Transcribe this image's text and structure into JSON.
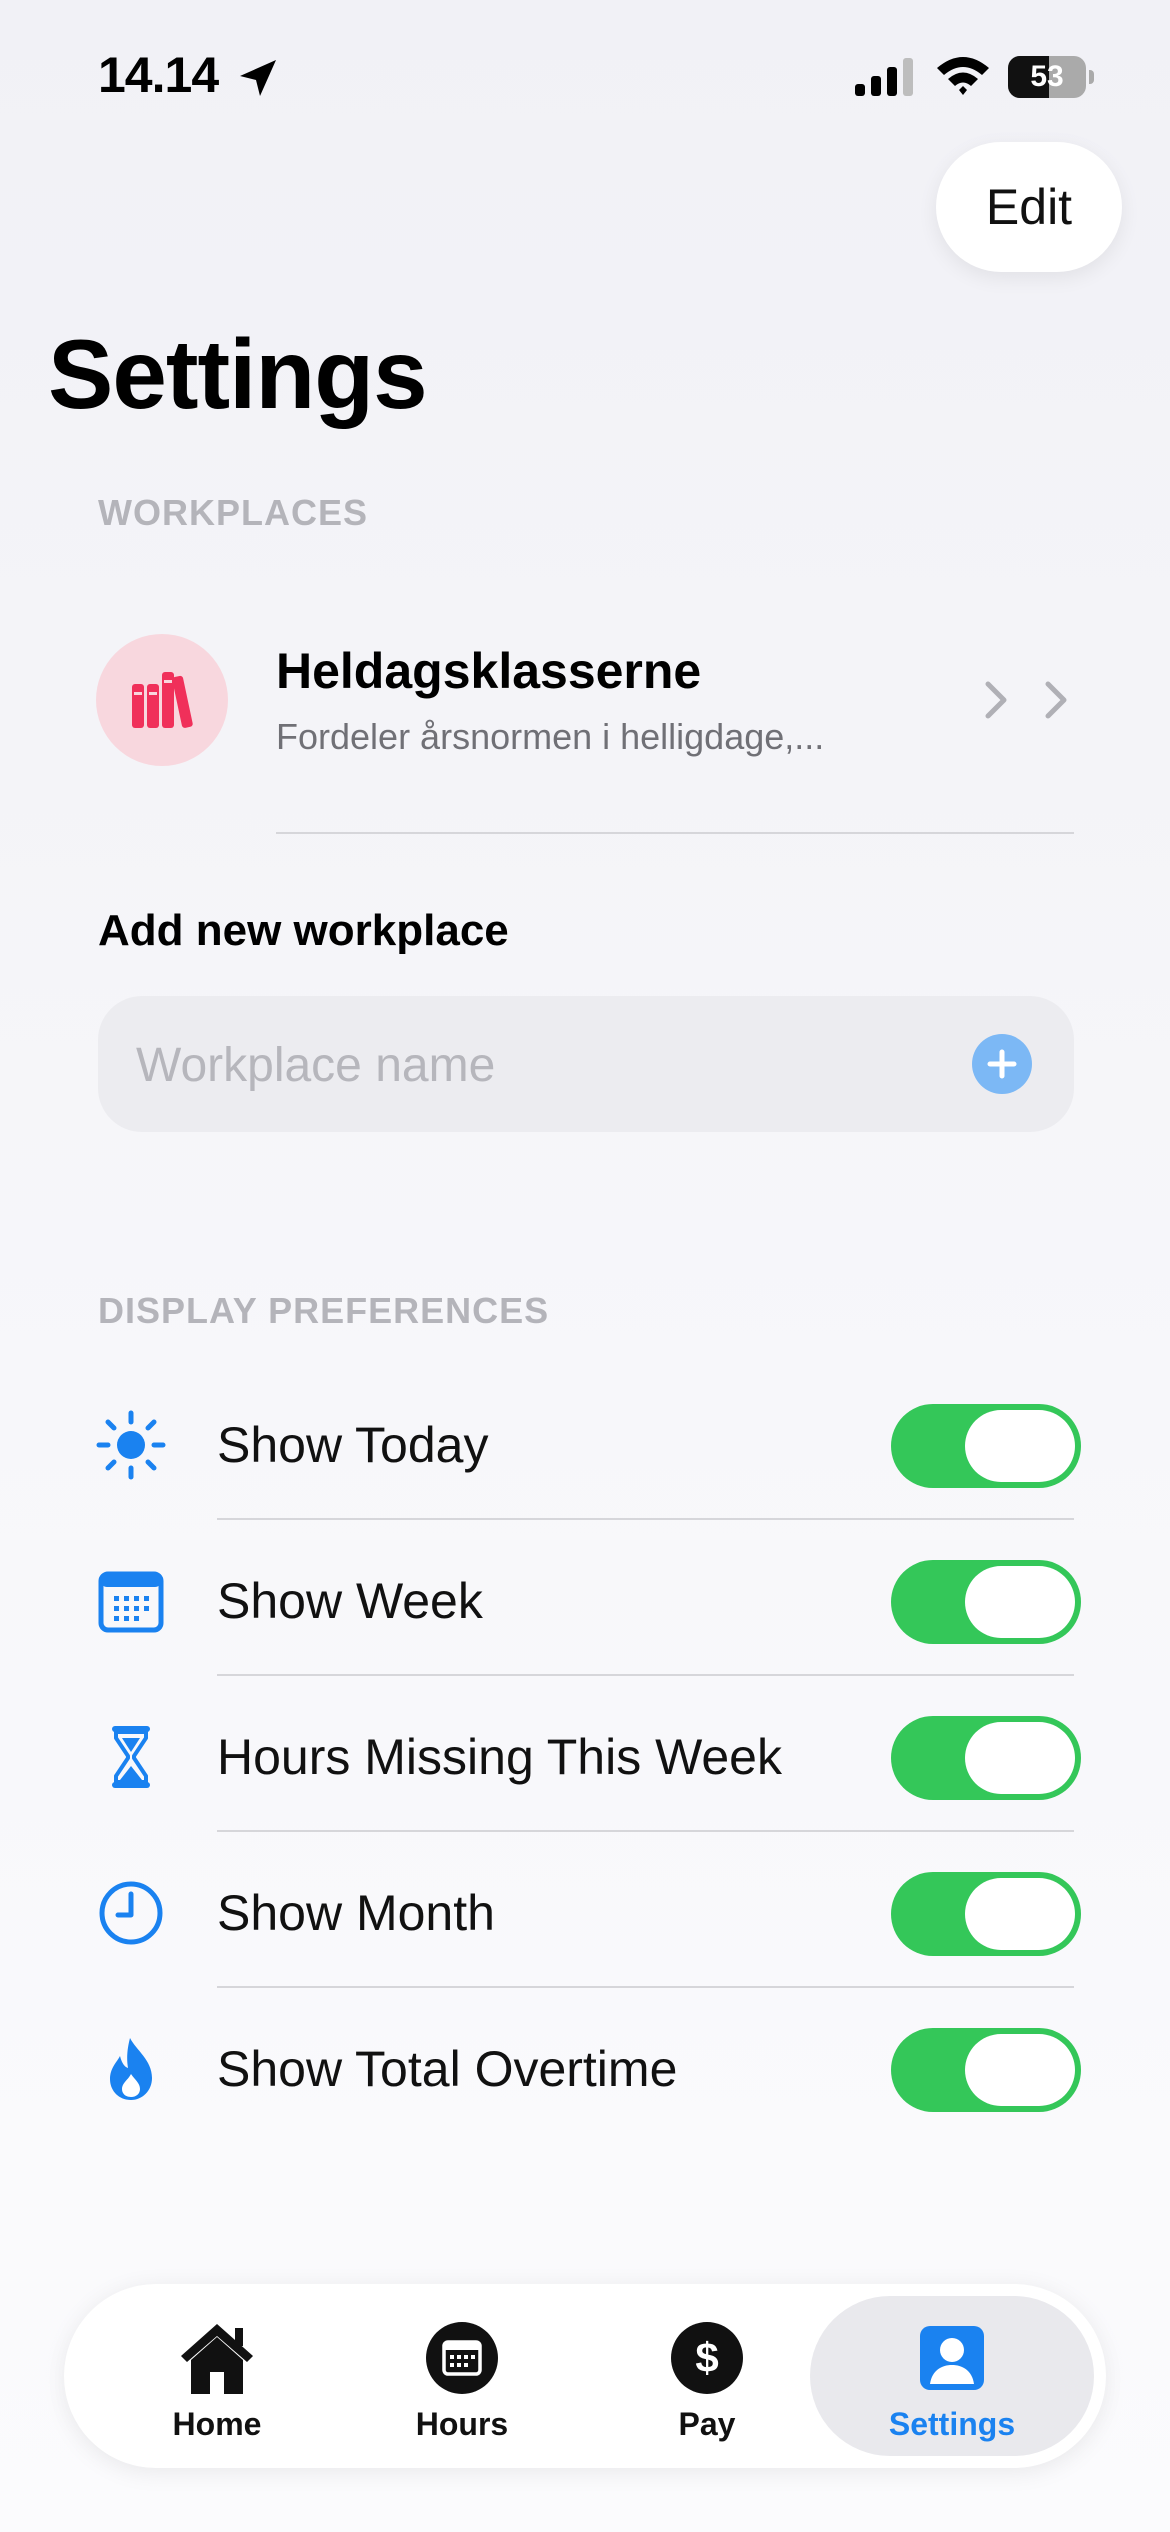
{
  "status_bar": {
    "time": "14.14",
    "battery": "53"
  },
  "header": {
    "edit_label": "Edit",
    "title": "Settings"
  },
  "workplaces": {
    "section_title": "WORKPLACES",
    "items": [
      {
        "name": "Heldagsklasserne",
        "subtitle": "Fordeler årsnormen i helligdage,..."
      }
    ],
    "add_label": "Add new workplace",
    "input_placeholder": "Workplace name",
    "input_value": ""
  },
  "display_preferences": {
    "section_title": "DISPLAY PREFERENCES",
    "items": [
      {
        "label": "Show Today",
        "icon": "sun-icon",
        "enabled": true
      },
      {
        "label": "Show Week",
        "icon": "calendar-icon",
        "enabled": true
      },
      {
        "label": "Hours Missing This Week",
        "icon": "hourglass-icon",
        "enabled": true
      },
      {
        "label": "Show Month",
        "icon": "clock-icon",
        "enabled": true
      },
      {
        "label": "Show Total Overtime",
        "icon": "flame-icon",
        "enabled": true
      }
    ]
  },
  "tab_bar": {
    "tabs": [
      {
        "label": "Home",
        "icon": "house-icon"
      },
      {
        "label": "Hours",
        "icon": "calendar-circle-icon"
      },
      {
        "label": "Pay",
        "icon": "dollar-circle-icon"
      },
      {
        "label": "Settings",
        "icon": "person-icon",
        "selected": true
      }
    ]
  },
  "colors": {
    "accent": "#1a82f0",
    "toggle_on": "#34c759",
    "workplace_icon": "#f0305a",
    "workplace_bg": "#f8d7de"
  }
}
